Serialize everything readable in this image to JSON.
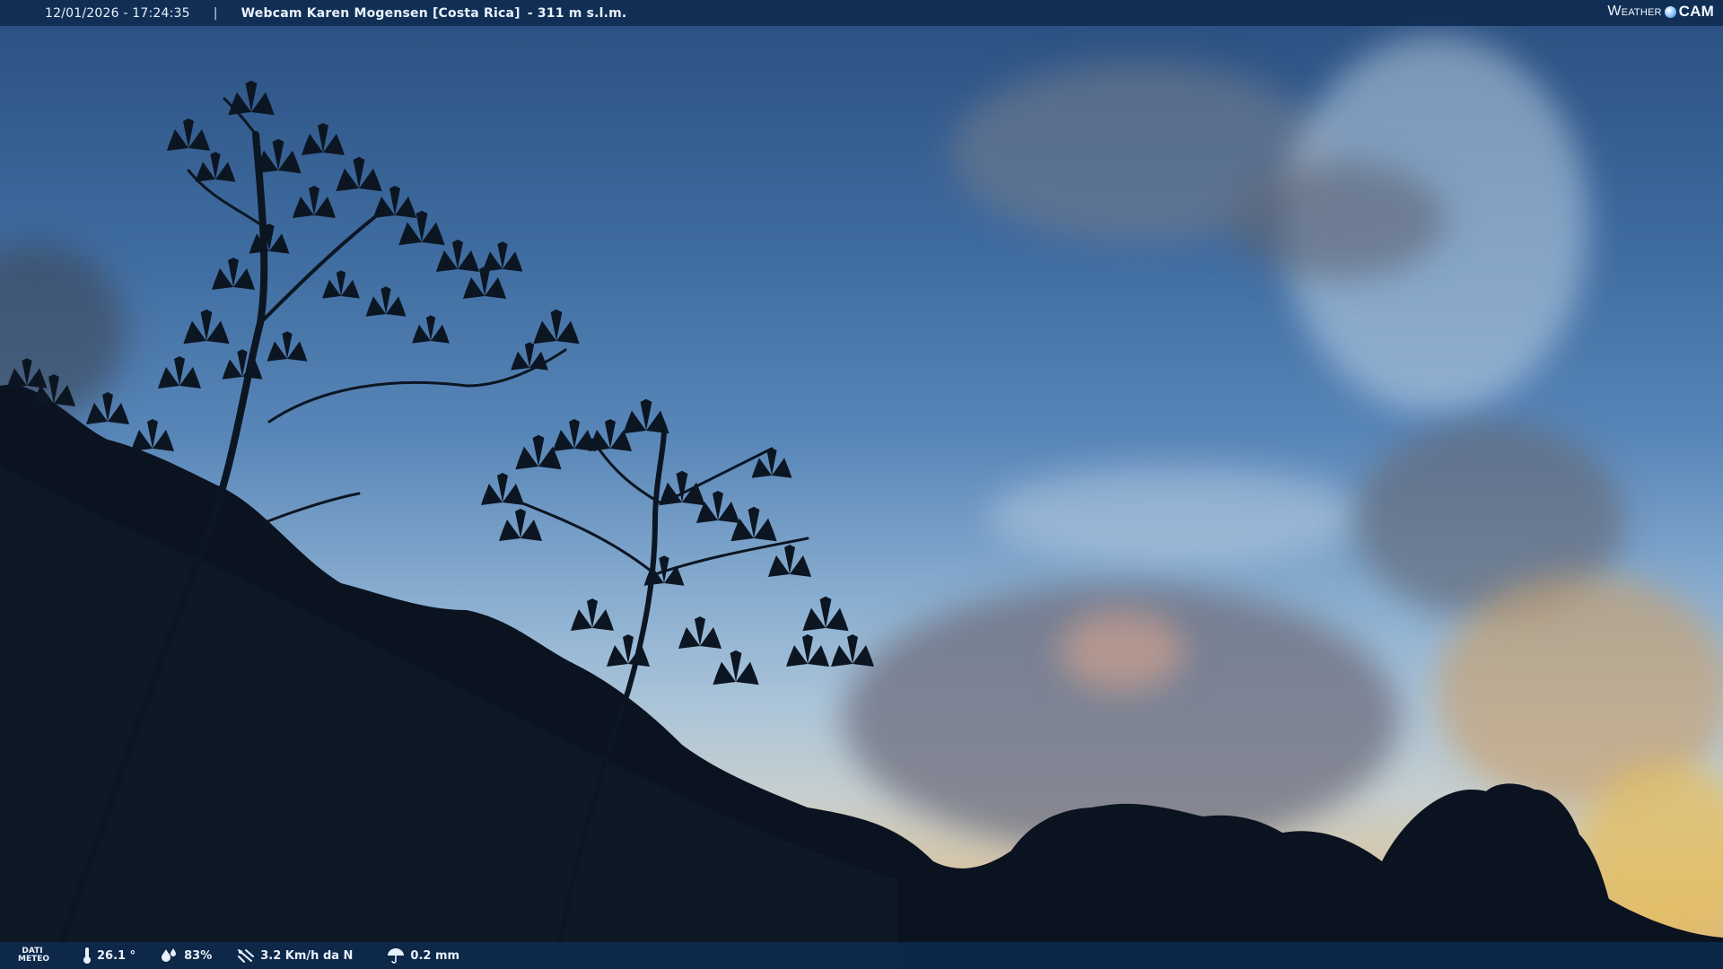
{
  "header": {
    "timestamp": "12/01/2026 - 17:24:35",
    "separator": "|",
    "title": "Webcam Karen Mogensen [Costa Rica]",
    "altitude": "- 311 m s.l.m."
  },
  "brand": {
    "word1": "Weather",
    "word2": "CAM"
  },
  "footer": {
    "meteo_label_line1": "DATI",
    "meteo_label_line2": "METEO",
    "temperature": "26.1 °",
    "humidity": "83%",
    "wind": "3.2 Km/h da N",
    "rain": "0.2 mm"
  },
  "icons": {
    "temperature": "thermometer-icon",
    "humidity": "droplets-icon",
    "wind": "wind-icon",
    "rain": "umbrella-icon"
  },
  "colors": {
    "bar_background": "#0e2a4e",
    "text": "#e9f1fb",
    "sky_top": "#2a4f7f",
    "sky_horizon": "#e0b36e"
  }
}
